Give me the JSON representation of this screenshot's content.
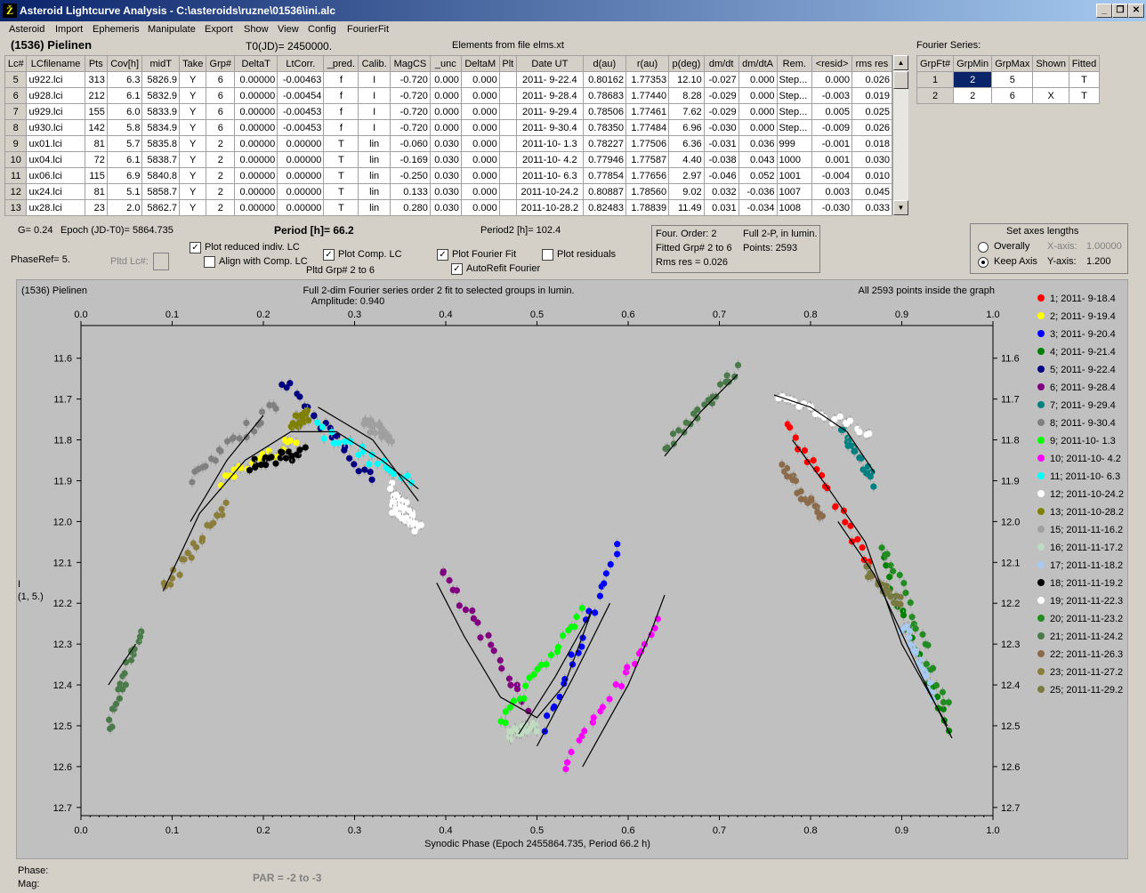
{
  "window": {
    "title": "Asteroid Lightcurve Analysis - C:\\asteroids\\ruzne\\01536\\ini.alc",
    "icon_text": "Ž"
  },
  "menu": [
    "Asteroid",
    "Import",
    "Ephemeris",
    "Manipulate",
    "Export",
    "Show",
    "View",
    "Config",
    "FourierFit"
  ],
  "header": {
    "object": "(1536) Pielinen",
    "t0": "T0(JD)= 2450000.",
    "elements": "Elements from file elms.xt"
  },
  "table": {
    "columns": [
      "Lc#",
      "LCfilename",
      "Pts",
      "Cov[h]",
      "midT",
      "Take",
      "Grp#",
      "DeltaT",
      "LtCorr.",
      "_pred.",
      "Calib.",
      "MagCS",
      "_unc",
      "DeltaM",
      "Plt",
      "Date UT",
      "d(au)",
      "r(au)",
      "p(deg)",
      "dm/dt",
      "dm/dtA",
      "Rem.",
      "<resid>",
      "rms res"
    ],
    "rows": [
      [
        "5",
        "u922.lci",
        "313",
        "6.3",
        "5826.9",
        "Y",
        "6",
        "0.00000",
        "-0.00463",
        "f",
        "I",
        "-0.720",
        "0.000",
        "0.000",
        "",
        "2011- 9-22.4",
        "0.80162",
        "1.77353",
        "12.10",
        "-0.027",
        "0.000",
        "Step...",
        "0.000",
        "0.026"
      ],
      [
        "6",
        "u928.lci",
        "212",
        "6.1",
        "5832.9",
        "Y",
        "6",
        "0.00000",
        "-0.00454",
        "f",
        "I",
        "-0.720",
        "0.000",
        "0.000",
        "",
        "2011- 9-28.4",
        "0.78683",
        "1.77440",
        "8.28",
        "-0.029",
        "0.000",
        "Step...",
        "-0.003",
        "0.019"
      ],
      [
        "7",
        "u929.lci",
        "155",
        "6.0",
        "5833.9",
        "Y",
        "6",
        "0.00000",
        "-0.00453",
        "f",
        "I",
        "-0.720",
        "0.000",
        "0.000",
        "",
        "2011- 9-29.4",
        "0.78506",
        "1.77461",
        "7.62",
        "-0.029",
        "0.000",
        "Step...",
        "0.005",
        "0.025"
      ],
      [
        "8",
        "u930.lci",
        "142",
        "5.8",
        "5834.9",
        "Y",
        "6",
        "0.00000",
        "-0.00453",
        "f",
        "I",
        "-0.720",
        "0.000",
        "0.000",
        "",
        "2011- 9-30.4",
        "0.78350",
        "1.77484",
        "6.96",
        "-0.030",
        "0.000",
        "Step...",
        "-0.009",
        "0.026"
      ],
      [
        "9",
        "ux01.lci",
        "81",
        "5.7",
        "5835.8",
        "Y",
        "2",
        "0.00000",
        "0.00000",
        "T",
        "lin",
        "-0.060",
        "0.030",
        "0.000",
        "",
        "2011-10- 1.3",
        "0.78227",
        "1.77506",
        "6.36",
        "-0.031",
        "0.036",
        "999",
        "-0.001",
        "0.018"
      ],
      [
        "10",
        "ux04.lci",
        "72",
        "6.1",
        "5838.7",
        "Y",
        "2",
        "0.00000",
        "0.00000",
        "T",
        "lin",
        "-0.169",
        "0.030",
        "0.000",
        "",
        "2011-10- 4.2",
        "0.77946",
        "1.77587",
        "4.40",
        "-0.038",
        "0.043",
        "1000",
        "0.001",
        "0.030"
      ],
      [
        "11",
        "ux06.lci",
        "115",
        "6.9",
        "5840.8",
        "Y",
        "2",
        "0.00000",
        "0.00000",
        "T",
        "lin",
        "-0.250",
        "0.030",
        "0.000",
        "",
        "2011-10- 6.3",
        "0.77854",
        "1.77656",
        "2.97",
        "-0.046",
        "0.052",
        "1001",
        "-0.004",
        "0.010"
      ],
      [
        "12",
        "ux24.lci",
        "81",
        "5.1",
        "5858.7",
        "Y",
        "2",
        "0.00000",
        "0.00000",
        "T",
        "lin",
        "0.133",
        "0.030",
        "0.000",
        "",
        "2011-10-24.2",
        "0.80887",
        "1.78560",
        "9.02",
        "0.032",
        "-0.036",
        "1007",
        "0.003",
        "0.045"
      ],
      [
        "13",
        "ux28.lci",
        "23",
        "2.0",
        "5862.7",
        "Y",
        "2",
        "0.00000",
        "0.00000",
        "T",
        "lin",
        "0.280",
        "0.030",
        "0.000",
        "",
        "2011-10-28.2",
        "0.82483",
        "1.78839",
        "11.49",
        "0.031",
        "-0.034",
        "1008",
        "-0.030",
        "0.033"
      ]
    ]
  },
  "fourier": {
    "title": "Fourier Series:",
    "columns": [
      "GrpFt#",
      "GrpMin",
      "GrpMax",
      "Shown",
      "Fitted"
    ],
    "rows": [
      [
        "1",
        "2",
        "5",
        "",
        "T"
      ],
      [
        "2",
        "2",
        "6",
        "X",
        "T"
      ]
    ]
  },
  "controls": {
    "g": "G= 0.24",
    "epoch": "Epoch (JD-T0)= 5864.735",
    "period": "Period [h]= 66.2",
    "period2": "Period2 [h]= 102.4",
    "phaseref": "PhaseRef= 5.",
    "pltd_lc": "Pltd Lc#:",
    "plot_reduced": "Plot reduced indiv. LC",
    "align": "Align with Comp. LC",
    "plot_comp": "Plot Comp. LC",
    "pltd_grp": "Pltd Grp#  2  to   6",
    "plot_fourier": "Plot Fourier Fit",
    "autorefit": "AutoRefit Fourier",
    "plot_residuals": "Plot residuals",
    "info1": "Four. Order:  2",
    "info2": "Fitted Grp# 2 to 6",
    "info3": "Rms res     = 0.026",
    "info4": "Full 2-P, in lumin.",
    "info5": "Points: 2593",
    "axes_title": "Set axes lengths",
    "overally": "Overally",
    "keep_axis": "Keep Axis",
    "xaxis_lbl": "X-axis:",
    "xaxis_val": "1.00000",
    "yaxis_lbl": "Y-axis:",
    "yaxis_val": "1.200"
  },
  "status": {
    "phase": "Phase:",
    "mag": "Mag:",
    "par": "PAR = -2 to -3"
  },
  "chart_data": {
    "type": "scatter",
    "title": "Full 2-dim Fourier series order 2 fit to selected groups in lumin.",
    "subtitle": "Amplitude: 0.940",
    "object_label": "(1536) Pielinen",
    "points_note": "All 2593 points inside the graph",
    "xlabel": "Synodic Phase (Epoch 2455864.735, Period 66.2 h)",
    "ylabel": "I",
    "ylabel2": "(1, 5.)",
    "xlim": [
      0,
      1
    ],
    "ylim": [
      11.52,
      12.72
    ],
    "y_inverted": true,
    "xticks": [
      "0.0",
      "0.1",
      "0.2",
      "0.3",
      "0.4",
      "0.5",
      "0.6",
      "0.7",
      "0.8",
      "0.9",
      "1.0"
    ],
    "yticks": [
      "11.6",
      "11.7",
      "11.8",
      "11.9",
      "12.0",
      "12.1",
      "12.2",
      "12.3",
      "12.4",
      "12.5",
      "12.6",
      "12.7"
    ],
    "series": [
      {
        "name": "1; 2011- 9-18.4",
        "color": "#ff0000",
        "segments": [
          [
            0.775,
            11.76,
            0.87,
            12.12
          ]
        ]
      },
      {
        "name": "2; 2011- 9-19.4",
        "color": "#ffff00",
        "segments": [
          [
            0.155,
            11.9,
            0.235,
            11.8
          ]
        ]
      },
      {
        "name": "3; 2011- 9-20.4",
        "color": "#0000ff",
        "segments": [
          [
            0.51,
            12.5,
            0.59,
            12.07
          ]
        ]
      },
      {
        "name": "4; 2011- 9-21.4",
        "color": "#008000",
        "segments": [
          [
            0.88,
            12.1,
            0.95,
            12.5
          ]
        ]
      },
      {
        "name": "5; 2011- 9-22.4",
        "color": "#000080",
        "segments": [
          [
            0.22,
            11.65,
            0.32,
            11.9
          ]
        ]
      },
      {
        "name": "6; 2011- 9-28.4",
        "color": "#800080",
        "segments": [
          [
            0.395,
            12.12,
            0.49,
            12.45
          ]
        ]
      },
      {
        "name": "7; 2011- 9-29.4",
        "color": "#008080",
        "segments": [
          [
            0.835,
            11.78,
            0.87,
            11.9
          ]
        ]
      },
      {
        "name": "8; 2011- 9-30.4",
        "color": "#808080",
        "segments": [
          [
            0.12,
            11.9,
            0.215,
            11.71
          ]
        ]
      },
      {
        "name": "9; 2011-10- 1.3",
        "color": "#00ff00",
        "segments": [
          [
            0.46,
            12.5,
            0.55,
            12.22
          ]
        ]
      },
      {
        "name": "10; 2011-10- 4.2",
        "color": "#ff00ff",
        "segments": [
          [
            0.53,
            12.6,
            0.635,
            12.24
          ]
        ]
      },
      {
        "name": "11; 2011-10- 6.3",
        "color": "#00ffff",
        "segments": [
          [
            0.26,
            11.77,
            0.36,
            11.9
          ]
        ]
      },
      {
        "name": "12; 2011-10-24.2",
        "color": "#ffffff",
        "segments": [
          [
            0.34,
            11.92,
            0.37,
            12.02
          ],
          [
            0.765,
            11.7,
            0.865,
            11.78
          ]
        ]
      },
      {
        "name": "13; 2011-10-28.2",
        "color": "#808000",
        "segments": [
          [
            0.23,
            11.76,
            0.25,
            11.74
          ]
        ]
      },
      {
        "name": "15; 2011-11-16.2",
        "color": "#a0a0a0",
        "segments": [
          [
            0.31,
            11.76,
            0.34,
            11.79
          ]
        ]
      },
      {
        "name": "16; 2011-11-17.2",
        "color": "#c0dcc0",
        "segments": [
          [
            0.47,
            12.52,
            0.5,
            12.5
          ]
        ]
      },
      {
        "name": "17; 2011-11-18.2",
        "color": "#a6caf0",
        "segments": [
          [
            0.9,
            12.25,
            0.935,
            12.42
          ]
        ]
      },
      {
        "name": "18; 2011-11-19.2",
        "color": "#000000",
        "segments": [
          [
            0.185,
            11.86,
            0.245,
            11.83
          ]
        ]
      },
      {
        "name": "19; 2011-11-22.3",
        "color": "#ffffff",
        "segments": [
          [
            0.34,
            11.96,
            0.365,
            12.0
          ]
        ]
      },
      {
        "name": "20; 2011-11-23.2",
        "color": "#228b22",
        "segments": [
          [
            0.88,
            12.05,
            0.95,
            12.45
          ]
        ]
      },
      {
        "name": "21; 2011-11-24.2",
        "color": "#4a7a4a",
        "segments": [
          [
            0.03,
            12.5,
            0.065,
            12.27
          ],
          [
            0.64,
            11.82,
            0.72,
            11.63
          ]
        ]
      },
      {
        "name": "22; 2011-11-26.3",
        "color": "#8b6b4a",
        "segments": [
          [
            0.77,
            11.87,
            0.815,
            12.0
          ]
        ]
      },
      {
        "name": "23; 2011-11-27.2",
        "color": "#8b7d3a",
        "segments": [
          [
            0.09,
            12.17,
            0.16,
            11.95
          ]
        ]
      },
      {
        "name": "25; 2011-11-29.2",
        "color": "#7a7a40",
        "segments": [
          [
            0.86,
            12.12,
            0.9,
            12.2
          ]
        ]
      }
    ],
    "fit_curves": [
      [
        [
          0.03,
          12.4
        ],
        [
          0.06,
          12.3
        ]
      ],
      [
        [
          0.09,
          12.17
        ],
        [
          0.13,
          11.98
        ],
        [
          0.18,
          11.85
        ],
        [
          0.23,
          11.78
        ],
        [
          0.28,
          11.78
        ],
        [
          0.33,
          11.85
        ],
        [
          0.37,
          11.92
        ]
      ],
      [
        [
          0.12,
          12.0
        ],
        [
          0.16,
          11.85
        ],
        [
          0.2,
          11.74
        ]
      ],
      [
        [
          0.26,
          11.72
        ],
        [
          0.32,
          11.8
        ],
        [
          0.37,
          11.95
        ]
      ],
      [
        [
          0.39,
          12.15
        ],
        [
          0.42,
          12.28
        ],
        [
          0.46,
          12.43
        ],
        [
          0.5,
          12.48
        ],
        [
          0.53,
          12.4
        ],
        [
          0.56,
          12.22
        ]
      ],
      [
        [
          0.48,
          12.52
        ],
        [
          0.52,
          12.38
        ],
        [
          0.56,
          12.22
        ]
      ],
      [
        [
          0.5,
          12.55
        ],
        [
          0.54,
          12.38
        ],
        [
          0.58,
          12.2
        ]
      ],
      [
        [
          0.55,
          12.6
        ],
        [
          0.6,
          12.4
        ],
        [
          0.625,
          12.27
        ],
        [
          0.64,
          12.18
        ]
      ],
      [
        [
          0.64,
          11.84
        ],
        [
          0.68,
          11.73
        ],
        [
          0.72,
          11.64
        ]
      ],
      [
        [
          0.76,
          11.69
        ],
        [
          0.8,
          11.72
        ],
        [
          0.84,
          11.78
        ],
        [
          0.87,
          11.88
        ]
      ],
      [
        [
          0.78,
          11.8
        ],
        [
          0.82,
          11.92
        ],
        [
          0.86,
          12.05
        ],
        [
          0.9,
          12.3
        ],
        [
          0.95,
          12.5
        ]
      ],
      [
        [
          0.83,
          12.0
        ],
        [
          0.87,
          12.13
        ],
        [
          0.92,
          12.37
        ],
        [
          0.955,
          12.53
        ]
      ]
    ]
  }
}
